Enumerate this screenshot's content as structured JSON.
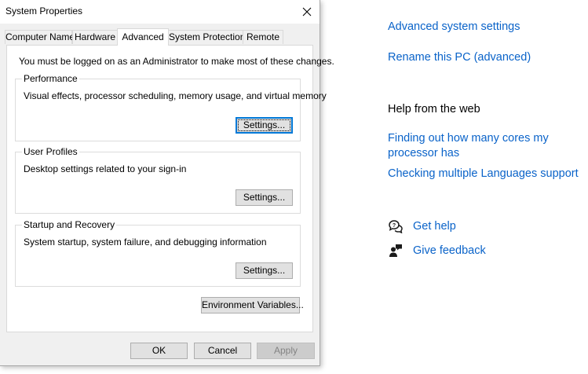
{
  "dialog": {
    "title": "System Properties",
    "tabs": [
      {
        "label": "Computer Name"
      },
      {
        "label": "Hardware"
      },
      {
        "label": "Advanced",
        "active": true
      },
      {
        "label": "System Protection"
      },
      {
        "label": "Remote"
      }
    ],
    "admin_note": "You must be logged on as an Administrator to make most of these changes.",
    "performance": {
      "title": "Performance",
      "description": "Visual effects, processor scheduling, memory usage, and virtual memory",
      "button": "Settings..."
    },
    "user_profiles": {
      "title": "User Profiles",
      "description": "Desktop settings related to your sign-in",
      "button": "Settings..."
    },
    "startup_recovery": {
      "title": "Startup and Recovery",
      "description": "System startup, system failure, and debugging information",
      "button": "Settings..."
    },
    "env_button": "Environment Variables...",
    "ok_button": "OK",
    "cancel_button": "Cancel",
    "apply_button": "Apply"
  },
  "settings_page": {
    "related_links": [
      "Advanced system settings",
      "Rename this PC (advanced)"
    ],
    "help_heading": "Help from the web",
    "help_links": [
      "Finding out how many cores my processor has",
      "Checking multiple Languages support"
    ],
    "get_help": {
      "label": "Get help",
      "icon": "chat-help-icon"
    },
    "give_feedback": {
      "label": "Give feedback",
      "icon": "feedback-person-icon"
    }
  },
  "colors": {
    "link": "#0a63c9",
    "dialog_bg": "#f0f0f0",
    "button_bg": "#e1e1e1",
    "focus_border": "#0078d7"
  }
}
